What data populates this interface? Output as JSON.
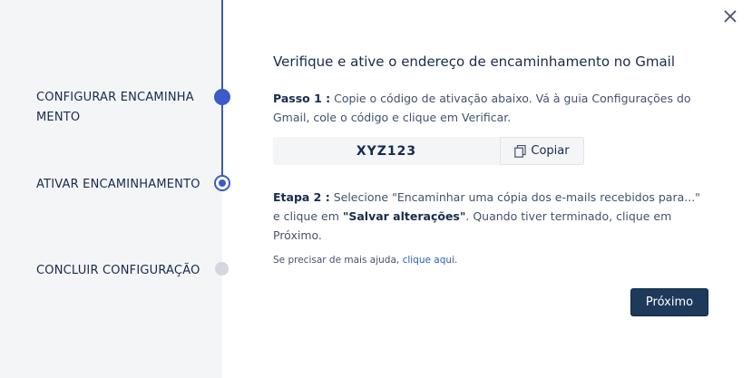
{
  "steps": [
    {
      "label": "CONFIGURAR ENCAMINHAMENTO",
      "state": "done"
    },
    {
      "label": "ATIVAR ENCAMINHAMENTO",
      "state": "active"
    },
    {
      "label": "CONCLUIR CONFIGURAÇÃO",
      "state": "pending"
    }
  ],
  "main": {
    "title": "Verifique e ative o endereço de encaminhamento no Gmail",
    "step1_prefix": "Passo 1 :",
    "step1_text": " Copie o código de ativação abaixo. Vá à guia Configurações do Gmail, cole o código e clique em Verificar.",
    "code": "XYZ123",
    "copy_label": "Copiar",
    "step2_prefix": "Etapa 2 :",
    "step2_text_a": " Selecione \"Encaminhar uma cópia dos e-mails recebidos para...\" e clique em ",
    "step2_bold": "\"Salvar alterações\"",
    "step2_text_b": ". Quando tiver terminado, clique em Próximo.",
    "help_text": "Se precisar de mais ajuda, ",
    "help_link": "clique aqui",
    "help_suffix": ".",
    "next_label": "Próximo"
  },
  "icons": {
    "close": "close-icon",
    "copy": "copy-icon"
  },
  "colors": {
    "accent": "#3b5bc8",
    "primary_button": "#1d3a5a",
    "link": "#2a5fb0"
  }
}
